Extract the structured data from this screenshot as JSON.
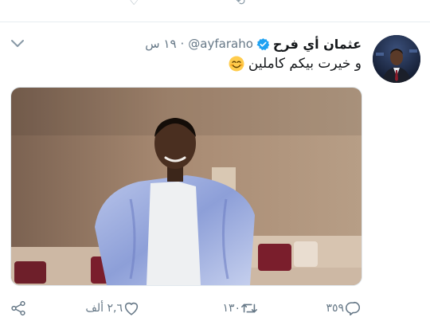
{
  "tweet": {
    "author_name": "عثمان أي فرح",
    "handle": "@ayfaraho",
    "separator": "·",
    "time": "١٩ س",
    "text": "و خيرت بيكم كاملين",
    "verified": true,
    "emoji": "smiling-face-with-smiling-eyes"
  },
  "actions": {
    "reply_count": "٣٥٩",
    "retweet_count": "١٣٠",
    "like_count": "٢,٦ ألف"
  },
  "icons": [
    "caret-down-icon",
    "verified-badge-icon",
    "reply-icon",
    "retweet-icon",
    "like-icon",
    "share-icon"
  ],
  "colors": {
    "verified_blue": "#1da1f2",
    "secondary_text": "#657786",
    "primary_text": "#14171a",
    "icon_gray": "#657786",
    "divider": "#e6ecf0"
  }
}
